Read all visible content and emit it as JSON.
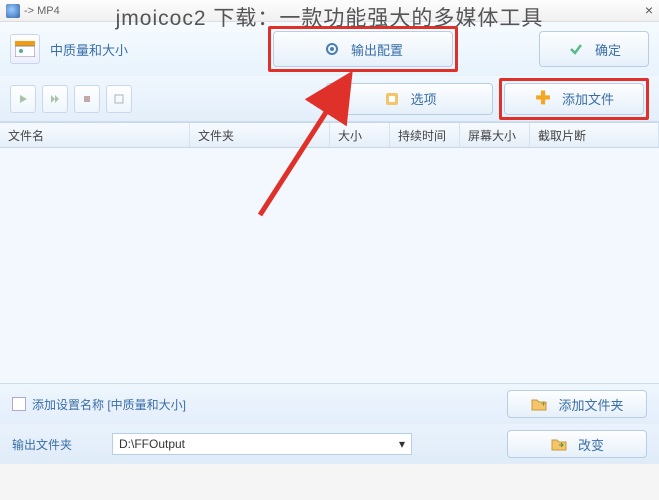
{
  "window": {
    "title": "-> MP4",
    "close": "×"
  },
  "overlay_title": "jmoicoc2 下载：一款功能强大的多媒体工具",
  "quality": {
    "label": "中质量和大小"
  },
  "buttons": {
    "output_config": "输出配置",
    "ok": "确定",
    "options": "选项",
    "add_file": "添加文件",
    "add_folder": "添加文件夹",
    "change": "改变"
  },
  "table": {
    "headers": {
      "name": "文件名",
      "folder": "文件夹",
      "size": "大小",
      "duration": "持续时间",
      "screen": "屏幕大小",
      "crop": "截取片断"
    }
  },
  "settings": {
    "checkbox_label": "添加设置名称  [中质量和大小]"
  },
  "output": {
    "label": "输出文件夹",
    "path": "D:\\FFOutput",
    "dropdown": "▾"
  }
}
